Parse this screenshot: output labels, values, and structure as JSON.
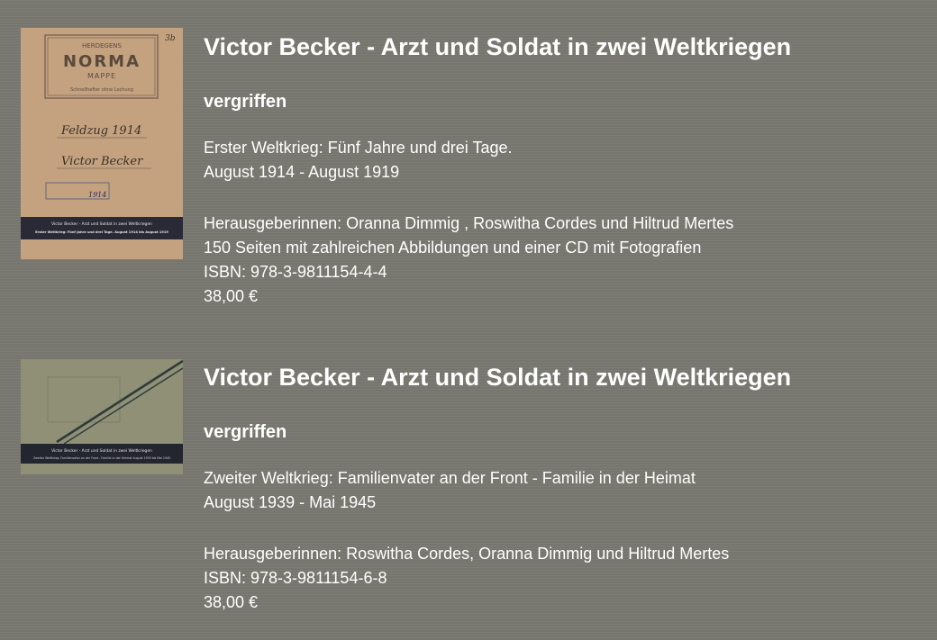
{
  "books": [
    {
      "cover": {
        "publisher_small": "HERDEGENS",
        "brand": "NORMA",
        "brand_sub": "MAPPE",
        "note": "Schnellhefter ohne Lochung",
        "handwriting_1": "Feldzug 1914",
        "handwriting_2": "Victor Becker",
        "corner_mark": "3b",
        "stamp": "1914",
        "band_line_1": "Victor Becker - Arzt und Soldat in zwei Weltkriegen",
        "band_line_2": "Erster Weltkrieg: Fünf Jahre und drei Tage. August 1914 bis August 1919"
      },
      "title": "Victor Becker - Arzt und Soldat in zwei Weltkriegen",
      "status": "vergriffen",
      "subtitle": "Erster Weltkrieg: Fünf Jahre und drei Tage.",
      "period": "August 1914 - August 1919",
      "editors": "Herausgeberinnen: Oranna Dimmig , Roswitha Cordes und Hiltrud Mertes",
      "pages": "150 Seiten mit zahlreichen Abbildungen und einer CD mit Fotografien",
      "isbn": "ISBN: 978-3-9811154-4-4",
      "price": "38,00 €"
    },
    {
      "cover": {
        "band_line_1": "Victor Becker - Arzt und Soldat in zwei Weltkriegen",
        "band_line_2": "Zweiter Weltkrieg: Familienvater an der Front - Familie in der Heimat August 1939 bis Mai 1945"
      },
      "title": "Victor Becker - Arzt und Soldat in zwei Weltkriegen",
      "status": "vergriffen",
      "subtitle": "Zweiter Weltkrieg: Familienvater an der Front - Familie in der Heimat",
      "period": "August 1939 - Mai 1945",
      "editors": "Herausgeberinnen: Roswitha Cordes, Oranna Dimmig und Hiltrud Mertes",
      "isbn": "ISBN: 978-3-9811154-6-8",
      "price": "38,00 €"
    }
  ]
}
